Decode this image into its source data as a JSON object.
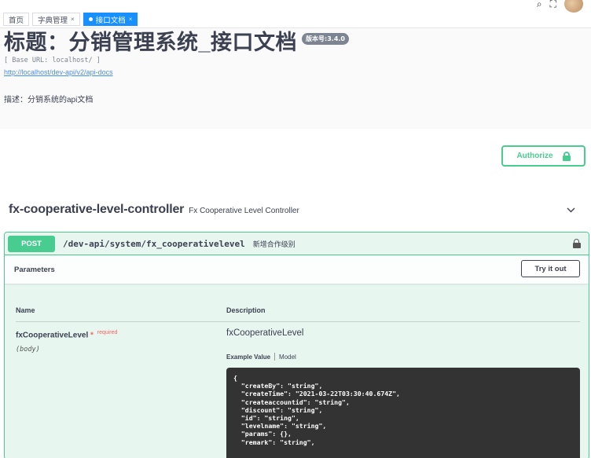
{
  "tabs": [
    {
      "label": "首页",
      "active": false,
      "closable": false
    },
    {
      "label": "字典管理",
      "active": false,
      "closable": true
    },
    {
      "label": "接口文档",
      "active": true,
      "closable": true
    }
  ],
  "info": {
    "title": "标题：分销管理系统_接口文档",
    "version": "版本号:3.4.0",
    "base_url": "[ Base URL: localhost/ ]",
    "docs_link": "http://localhost/dev-api/v2/api-docs",
    "description": "描述：分销系统的api文档"
  },
  "scheme": {
    "authorize_label": "Authorize"
  },
  "controller": {
    "name": "fx-cooperative-level-controller",
    "description": "Fx Cooperative Level Controller",
    "operation": {
      "method": "POST",
      "path": "/dev-api/system/fx_cooperativelevel",
      "summary": "新增合作级别",
      "parameters_title": "Parameters",
      "try_it_out": "Try it out",
      "col_name": "Name",
      "col_description": "Description",
      "param": {
        "name": "fxCooperativeLevel",
        "required_star": "*",
        "required_label": "required",
        "in": "(body)",
        "description": "fxCooperativeLevel",
        "example_value_tab": "Example Value",
        "model_tab": "Model",
        "example_json": "{\n  \"createBy\": \"string\",\n  \"createTime\": \"2021-03-22T03:30:40.674Z\",\n  \"createaccountid\": \"string\",\n  \"discount\": \"string\",\n  \"id\": \"string\",\n  \"levelname\": \"string\",\n  \"params\": {},\n  \"remark\": \"string\","
      }
    }
  },
  "colors": {
    "post_green": "#49cc90",
    "tab_active_blue": "#1890ff",
    "text_dark": "#3b4151",
    "link_blue": "#4990e2",
    "required_red": "#ff6060"
  }
}
